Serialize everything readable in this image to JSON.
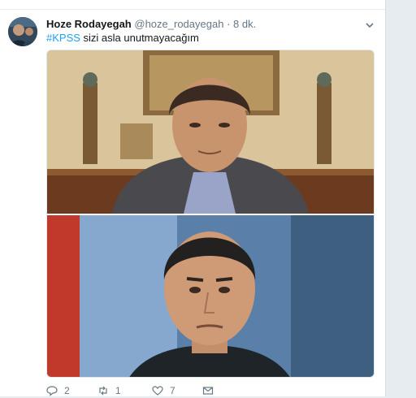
{
  "tweet": {
    "display_name": "Hoze Rodayegah",
    "handle": "@hoze_rodayegah",
    "separator": "·",
    "time": "8 dk.",
    "hashtag": "#KPSS",
    "text": " sizi asla unutmayacağım"
  },
  "actions": {
    "reply_count": "2",
    "retweet_count": "1",
    "like_count": "7"
  },
  "colors": {
    "link": "#1da1f2",
    "secondary_text": "#657786",
    "page_bg": "#e6ecf0"
  },
  "icons": [
    "caret-down-icon",
    "reply-icon",
    "retweet-icon",
    "like-icon",
    "message-icon"
  ]
}
